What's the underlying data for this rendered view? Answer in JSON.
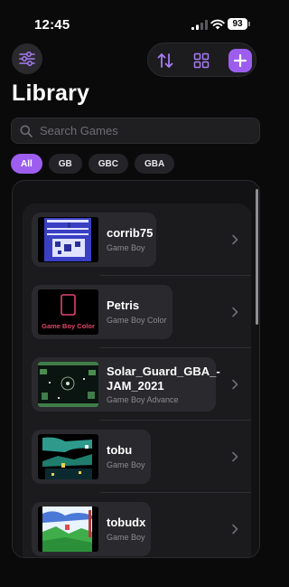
{
  "status": {
    "time": "12:45",
    "battery": "93"
  },
  "header": {
    "title": "Library"
  },
  "search": {
    "placeholder": "Search Games"
  },
  "filters": [
    "All",
    "GB",
    "GBC",
    "GBA"
  ],
  "games": [
    {
      "title": "corrib75",
      "platform": "Game Boy"
    },
    {
      "title": "Petris",
      "platform": "Game Boy Color",
      "thumb_caption": "Game Boy Color"
    },
    {
      "title": "Solar_Guard_GBA_-JAM_2021",
      "platform": "Game Boy Advance"
    },
    {
      "title": "tobu",
      "platform": "Game Boy"
    },
    {
      "title": "tobudx",
      "platform": "Game Boy"
    }
  ],
  "colors": {
    "accent": "#9d5ef0",
    "background": "#0a0a0b",
    "petris_pink": "#e0446a"
  }
}
